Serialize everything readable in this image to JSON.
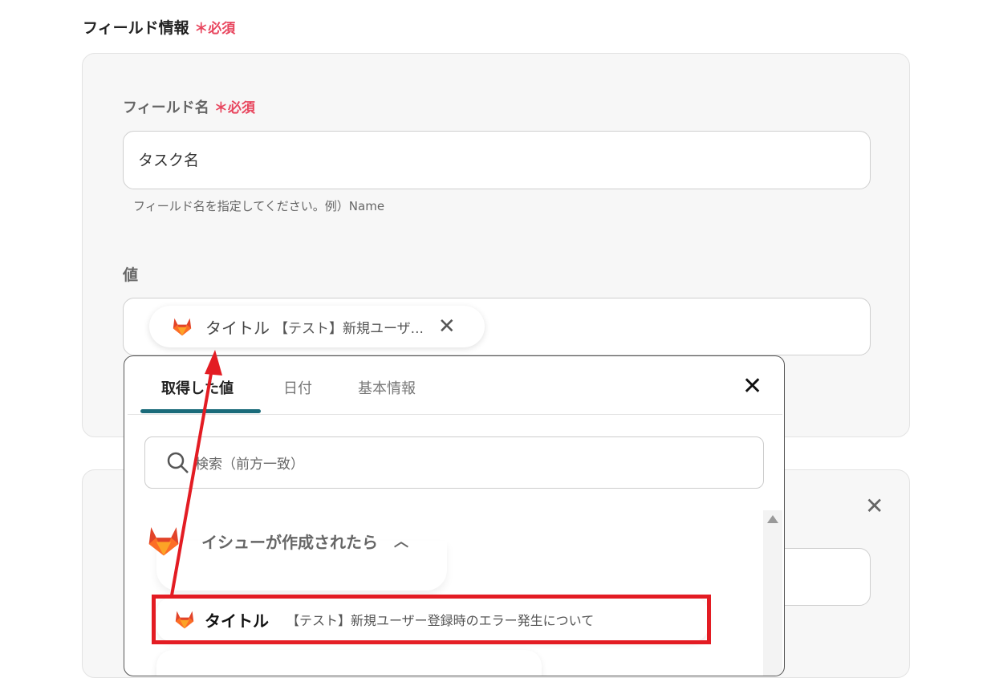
{
  "section": {
    "title": "フィールド情報",
    "required": "必須"
  },
  "field_name": {
    "label": "フィールド名",
    "required": "必須",
    "value": "タスク名",
    "hint": "フィールド名を指定してください。例）Name"
  },
  "value": {
    "label": "値",
    "chip": {
      "label": "タイトル",
      "value": "【テスト】新規ユーザ..."
    }
  },
  "dropdown": {
    "tabs": [
      {
        "label": "取得した値",
        "active": true
      },
      {
        "label": "日付"
      },
      {
        "label": "基本情報"
      }
    ],
    "search_placeholder": "検索（前方一致）",
    "group": {
      "title": "イシューが作成されたら"
    },
    "items": [
      {
        "label": "タイトル",
        "value": "【テスト】新規ユーザー登録時のエラー発生について"
      }
    ]
  },
  "colors": {
    "accent": "#1a6b7a",
    "required": "#e8475f",
    "highlight": "#e31c23"
  }
}
